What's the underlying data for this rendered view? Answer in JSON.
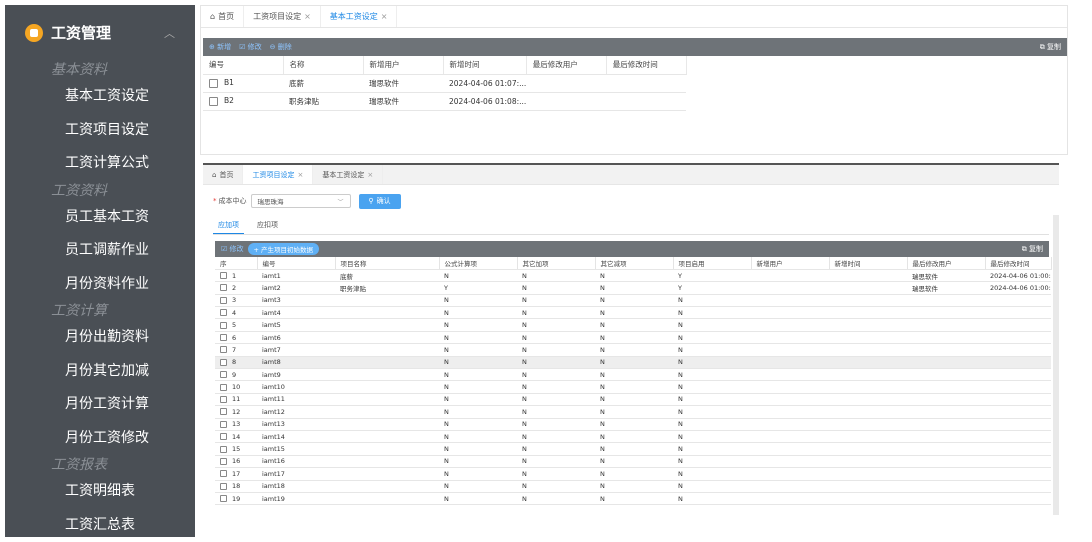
{
  "sidebar": {
    "title": "工资管理",
    "groups": [
      {
        "title": "基本资料",
        "items": [
          "基本工资设定",
          "工资项目设定",
          "工资计算公式"
        ]
      },
      {
        "title": "工资资料",
        "items": [
          "员工基本工资",
          "员工调薪作业",
          "月份资料作业"
        ]
      },
      {
        "title": "工资计算",
        "items": [
          "月份出勤资料",
          "月份其它加减",
          "月份工资计算",
          "月份工资修改"
        ]
      },
      {
        "title": "工资报表",
        "items": [
          "工资明细表",
          "工资汇总表"
        ]
      }
    ]
  },
  "win1": {
    "tabs": [
      {
        "label": "首页",
        "icon": "home-icon",
        "closable": false
      },
      {
        "label": "工资项目设定",
        "closable": true
      },
      {
        "label": "基本工资设定",
        "closable": true,
        "active": true
      }
    ],
    "toolbar": {
      "add": "⊕ 新增",
      "edit": "☑ 修改",
      "delete": "⊖ 删除",
      "copy": "复制"
    },
    "columns": [
      "编号",
      "名称",
      "新增用户",
      "新增时间",
      "最后修改用户",
      "最后修改时间"
    ],
    "rows": [
      [
        "B1",
        "底薪",
        "瑞思软件",
        "2024-04-06 01:07:...",
        "",
        ""
      ],
      [
        "B2",
        "职务津贴",
        "瑞思软件",
        "2024-04-06 01:08:...",
        "",
        ""
      ]
    ]
  },
  "win2": {
    "tabs": [
      {
        "label": "首页",
        "icon": "home-icon",
        "closable": false
      },
      {
        "label": "工资项目设定",
        "closable": true,
        "active": true
      },
      {
        "label": "基本工资设定",
        "closable": true
      }
    ],
    "form": {
      "label": "成本中心",
      "value": "瑞思珠海",
      "confirm": "确认"
    },
    "subtabs": [
      "应加项",
      "应扣项"
    ],
    "toolbar": {
      "edit": "☑ 修改",
      "generate": "+ 产生项目初始数据",
      "copy": "复制"
    },
    "columns": [
      "序",
      "编号",
      "项目名称",
      "公式计算项",
      "其它加项",
      "其它减项",
      "项目启用",
      "新增用户",
      "新增时间",
      "最后修改用户",
      "最后修改时间"
    ],
    "rows": [
      [
        "1",
        "iamt1",
        "底薪",
        "N",
        "N",
        "N",
        "Y",
        "",
        "",
        "瑞思软件",
        "2024-04-06 01:00:..."
      ],
      [
        "2",
        "iamt2",
        "职务津贴",
        "Y",
        "N",
        "N",
        "Y",
        "",
        "",
        "瑞思软件",
        "2024-04-06 01:00:..."
      ],
      [
        "3",
        "iamt3",
        "",
        "N",
        "N",
        "N",
        "N",
        "",
        "",
        "",
        ""
      ],
      [
        "4",
        "iamt4",
        "",
        "N",
        "N",
        "N",
        "N",
        "",
        "",
        "",
        ""
      ],
      [
        "5",
        "iamt5",
        "",
        "N",
        "N",
        "N",
        "N",
        "",
        "",
        "",
        ""
      ],
      [
        "6",
        "iamt6",
        "",
        "N",
        "N",
        "N",
        "N",
        "",
        "",
        "",
        ""
      ],
      [
        "7",
        "iamt7",
        "",
        "N",
        "N",
        "N",
        "N",
        "",
        "",
        "",
        ""
      ],
      [
        "8",
        "iamt8",
        "",
        "N",
        "N",
        "N",
        "N",
        "",
        "",
        "",
        ""
      ],
      [
        "9",
        "iamt9",
        "",
        "N",
        "N",
        "N",
        "N",
        "",
        "",
        "",
        ""
      ],
      [
        "10",
        "iamt10",
        "",
        "N",
        "N",
        "N",
        "N",
        "",
        "",
        "",
        ""
      ],
      [
        "11",
        "iamt11",
        "",
        "N",
        "N",
        "N",
        "N",
        "",
        "",
        "",
        ""
      ],
      [
        "12",
        "iamt12",
        "",
        "N",
        "N",
        "N",
        "N",
        "",
        "",
        "",
        ""
      ],
      [
        "13",
        "iamt13",
        "",
        "N",
        "N",
        "N",
        "N",
        "",
        "",
        "",
        ""
      ],
      [
        "14",
        "iamt14",
        "",
        "N",
        "N",
        "N",
        "N",
        "",
        "",
        "",
        ""
      ],
      [
        "15",
        "iamt15",
        "",
        "N",
        "N",
        "N",
        "N",
        "",
        "",
        "",
        ""
      ],
      [
        "16",
        "iamt16",
        "",
        "N",
        "N",
        "N",
        "N",
        "",
        "",
        "",
        ""
      ],
      [
        "17",
        "iamt17",
        "",
        "N",
        "N",
        "N",
        "N",
        "",
        "",
        "",
        ""
      ],
      [
        "18",
        "iamt18",
        "",
        "N",
        "N",
        "N",
        "N",
        "",
        "",
        "",
        ""
      ],
      [
        "19",
        "iamt19",
        "",
        "N",
        "N",
        "N",
        "N",
        "",
        "",
        "",
        ""
      ]
    ]
  }
}
